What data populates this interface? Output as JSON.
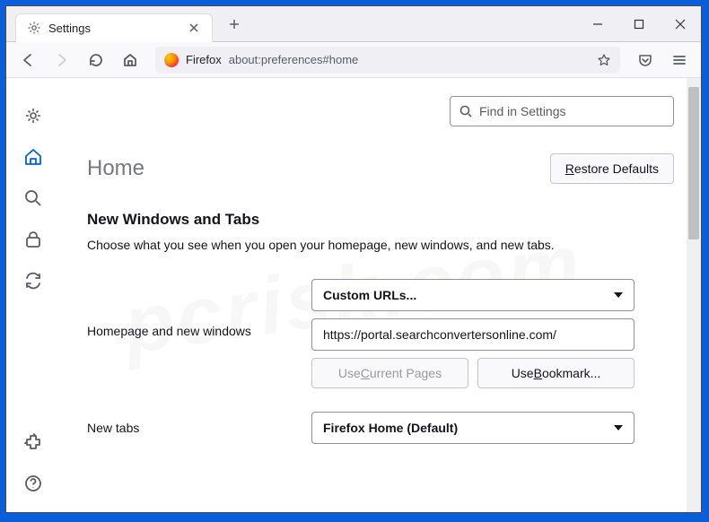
{
  "titlebar": {
    "tab_title": "Settings"
  },
  "toolbar": {
    "brand": "Firefox",
    "url": "about:preferences#home"
  },
  "search": {
    "placeholder": "Find in Settings"
  },
  "page": {
    "heading": "Home",
    "restore_defaults": "estore Defaults",
    "restore_defaults_u": "R",
    "section_title": "New Windows and Tabs",
    "section_desc": "Choose what you see when you open your homepage, new windows, and new tabs.",
    "homepage_label": "Homepage and new windows",
    "homepage_select": "Custom URLs...",
    "homepage_url": "https://portal.searchconvertersonline.com/",
    "use_current_pre": "Use ",
    "use_current_u": "C",
    "use_current_post": "urrent Pages",
    "use_bookmark_pre": "Use ",
    "use_bookmark_u": "B",
    "use_bookmark_post": "ookmark...",
    "newtabs_label": "New tabs",
    "newtabs_select": "Firefox Home (Default)"
  },
  "watermark": "pcrisk.com"
}
